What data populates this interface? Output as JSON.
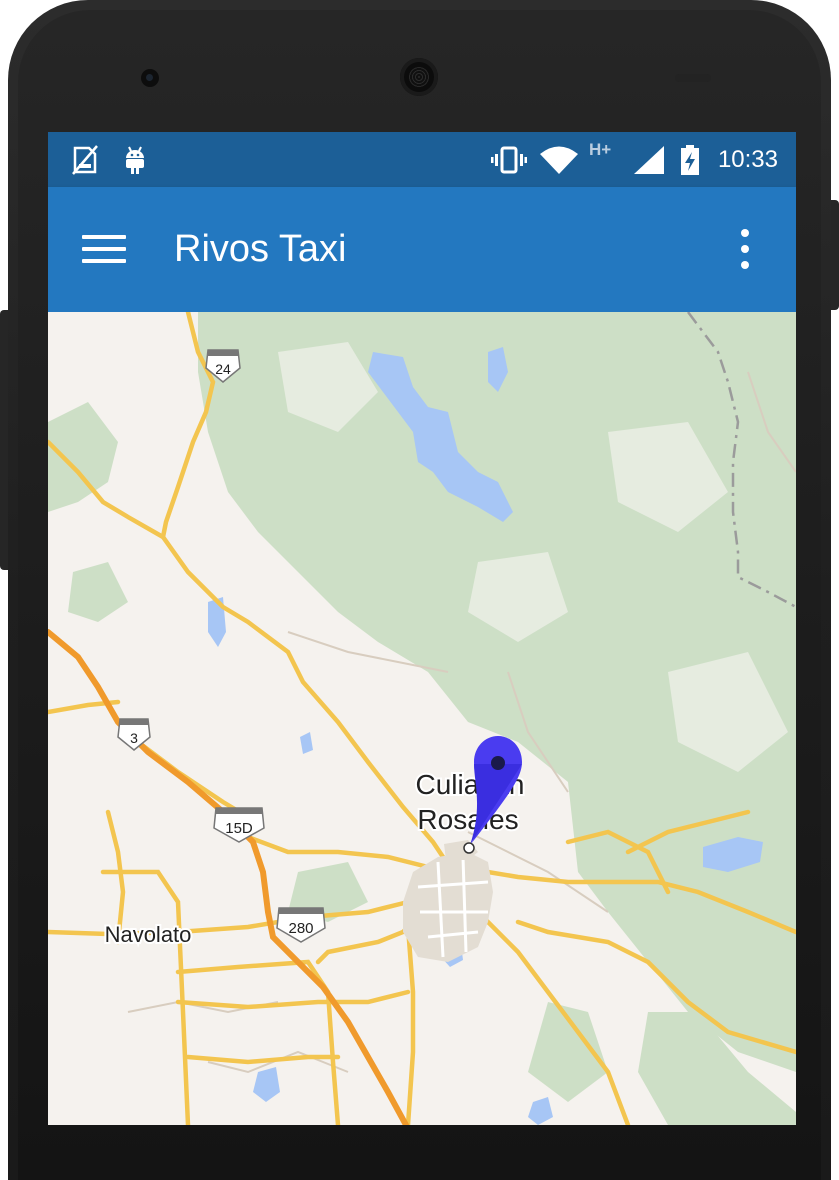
{
  "status_bar": {
    "time": "10:33",
    "network_type": "H+",
    "icons": [
      "no-sim-icon",
      "android-icon",
      "vibrate-icon",
      "wifi-icon",
      "signal-icon",
      "battery-charging-icon"
    ]
  },
  "app_bar": {
    "title": "Rivos Taxi",
    "menu_icon": "hamburger-menu-icon",
    "overflow_icon": "more-vert-icon"
  },
  "map": {
    "places": {
      "city_line1": "Culiacán",
      "city_line2": "Rosales",
      "town": "Navolato"
    },
    "highway_shields": {
      "hw24": "24",
      "hw3": "3",
      "hw15d": "15D",
      "hw280": "280"
    },
    "marker": "location-pin-icon"
  },
  "colors": {
    "status_bar": "#1c5f97",
    "app_bar": "#2378c0",
    "map_land": "#f5f2ee",
    "map_forest": "#cddfc6",
    "map_water": "#a7c6f5",
    "road_major": "#f3c54f",
    "road_highway": "#f09a2c",
    "marker": "#4a3cf0"
  }
}
